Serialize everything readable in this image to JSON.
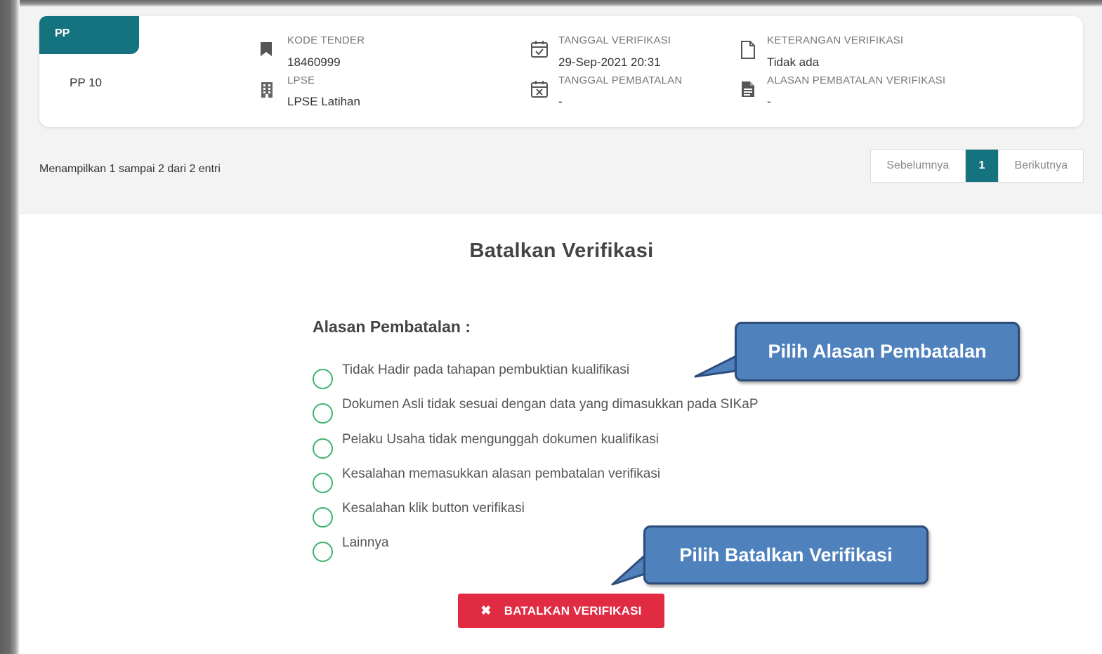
{
  "card": {
    "tab_label": "PP",
    "pp_code": "PP 10",
    "kode_tender_label": "KODE TENDER",
    "kode_tender_value": "18460999",
    "lpse_label": "LPSE",
    "lpse_value": "LPSE Latihan",
    "tanggal_verifikasi_label": "TANGGAL VERIFIKASI",
    "tanggal_verifikasi_value": "29-Sep-2021 20:31",
    "tanggal_pembatalan_label": "TANGGAL PEMBATALAN",
    "tanggal_pembatalan_value": "-",
    "keterangan_label": "KETERANGAN VERIFIKASI",
    "keterangan_value": "Tidak ada",
    "alasan_label": "ALASAN PEMBATALAN VERIFIKASI",
    "alasan_value": "-"
  },
  "table_info": "Menampilkan 1 sampai 2 dari 2 entri",
  "pagination": {
    "prev": "Sebelumnya",
    "current": "1",
    "next": "Berikutnya"
  },
  "section_title": "Batalkan Verifikasi",
  "reason_label": "Alasan Pembatalan :",
  "reasons": [
    "Tidak Hadir pada tahapan pembuktian kualifikasi",
    "Dokumen Asli tidak sesuai dengan data yang dimasukkan pada SIKaP",
    "Pelaku Usaha tidak mengunggah dokumen kualifikasi",
    "Kesalahan memasukkan alasan pembatalan verifikasi",
    "Kesalahan klik button verifikasi",
    "Lainnya"
  ],
  "cancel_button": {
    "icon": "times-icon",
    "label": "BATALKAN VERIFIKASI"
  },
  "callouts": {
    "reason": "Pilih Alasan Pembatalan",
    "button": "Pilih Batalkan Verifikasi"
  },
  "colors": {
    "teal": "#15727f",
    "radio_green": "#3cb372",
    "danger": "#e02b43",
    "callout_fill": "#4f81bd",
    "callout_border": "#2e4d7b"
  }
}
